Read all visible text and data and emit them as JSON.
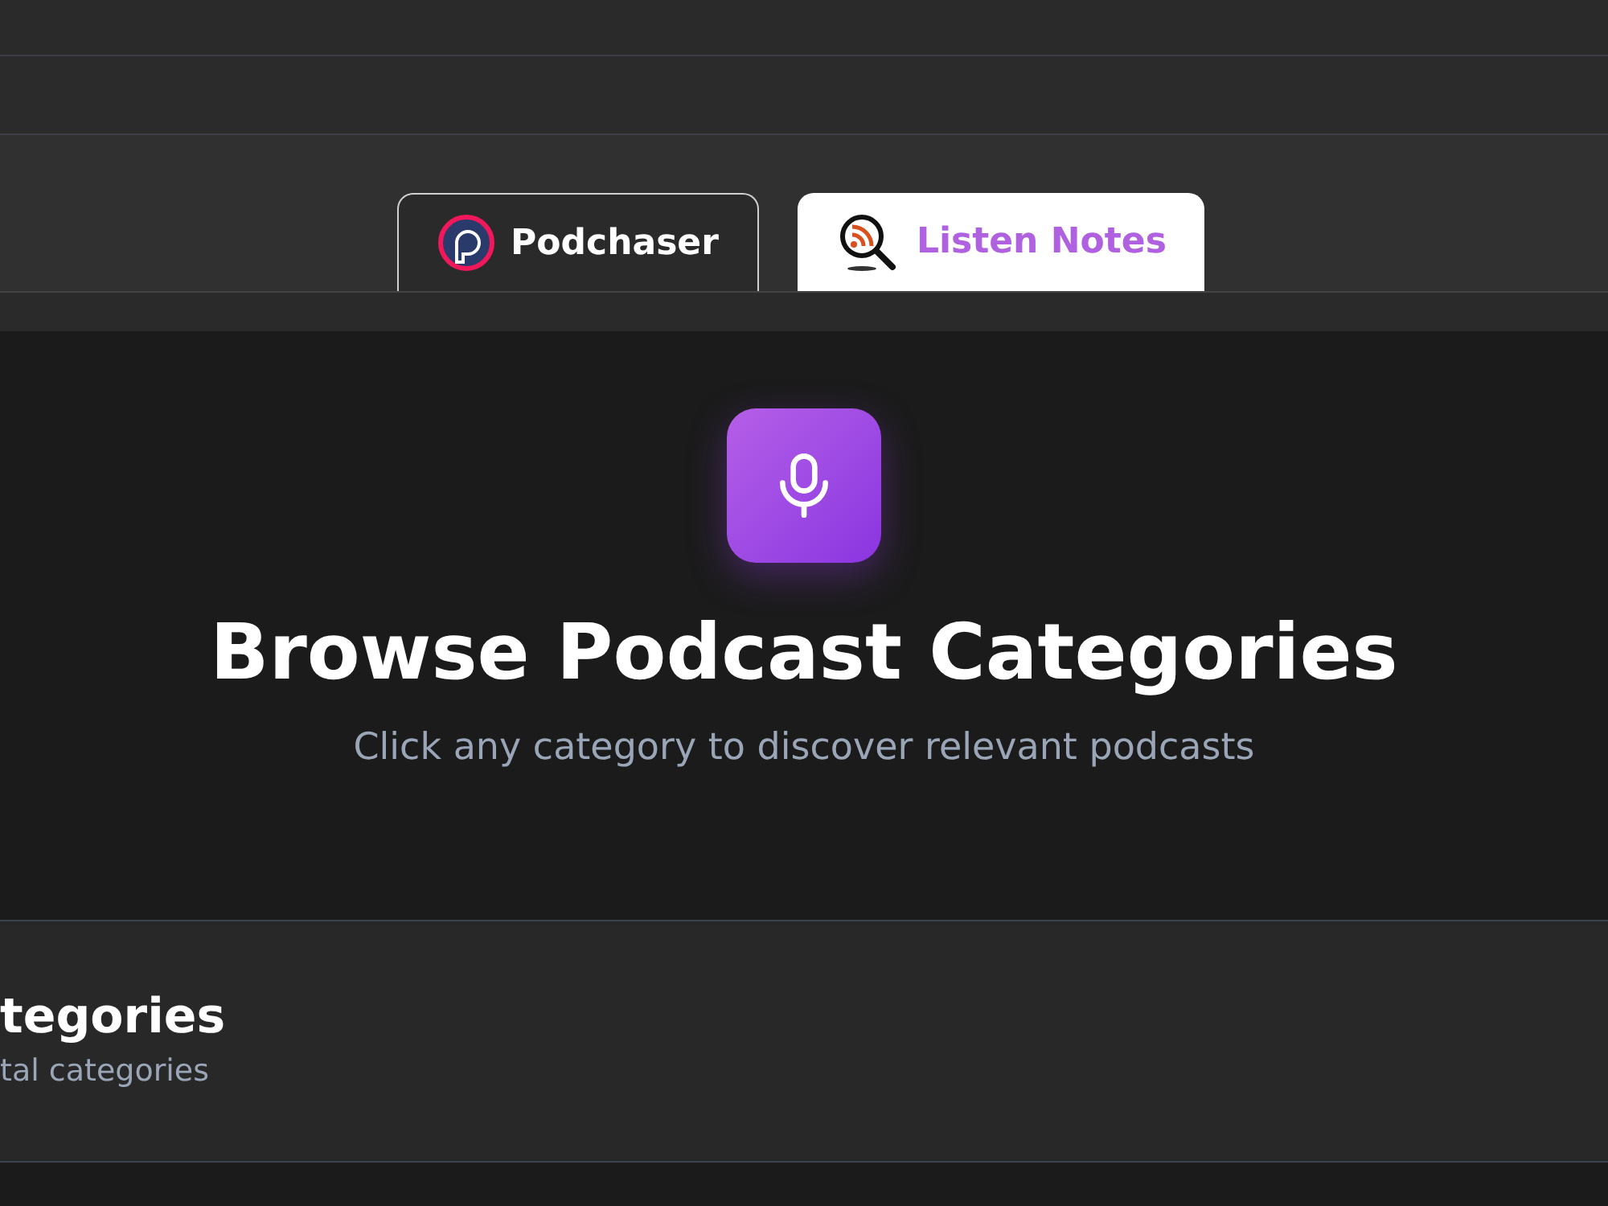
{
  "tabs": [
    {
      "label": "Podchaser",
      "selected": false
    },
    {
      "label": "Listen Notes",
      "selected": true
    }
  ],
  "hero": {
    "title": "Browse Podcast Categories",
    "subtitle": "Click any category to discover relevant podcasts"
  },
  "section": {
    "title": "tegories",
    "subtitle": "tal categories"
  }
}
